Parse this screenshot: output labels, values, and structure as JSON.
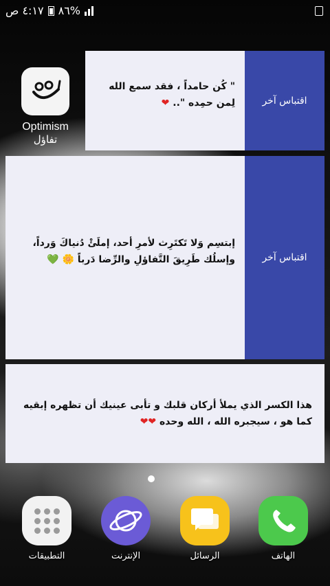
{
  "status_bar": {
    "time": "٤:١٧ ص",
    "battery": "%٨٦"
  },
  "home_app": {
    "name": "Optimism",
    "subtitle": "تفاؤل"
  },
  "widgets": [
    {
      "quote": "\" كُن حامداً ، فقد سمع الله لِمن حمِده \"..",
      "heart": "❤",
      "more_label": "اقتباس آخر"
    },
    {
      "quote": "إبتسِم وَلا تَكتَرِث لأمرِ أحد، إملَئْ دُنياكَ وَرداً، وإسلُك طَرِيقَ التَّفاؤلِ والرِّضا دَرباً",
      "emoji": "🌼",
      "heart": "💚",
      "more_label": "اقتباس آخر"
    },
    {
      "quote": "هذا الكسر الذي يملأ أركان قلبك و تأبى عينيك أن تظهره إبقيه كما هو ، سيجبره الله ، الله وحده",
      "hearts": "❤❤"
    }
  ],
  "dock": [
    {
      "label": "التطبيقات",
      "icon": "apps-grid-icon"
    },
    {
      "label": "الإنترنت",
      "icon": "internet-planet-icon"
    },
    {
      "label": "الرسائل",
      "icon": "messages-icon"
    },
    {
      "label": "الهاتف",
      "icon": "phone-icon"
    }
  ],
  "colors": {
    "widget_bg": "#eeeef7",
    "more_panel": "#3948a8",
    "internet": "#6b5bd6",
    "messages": "#f7c21b",
    "phone": "#4cc94c"
  }
}
